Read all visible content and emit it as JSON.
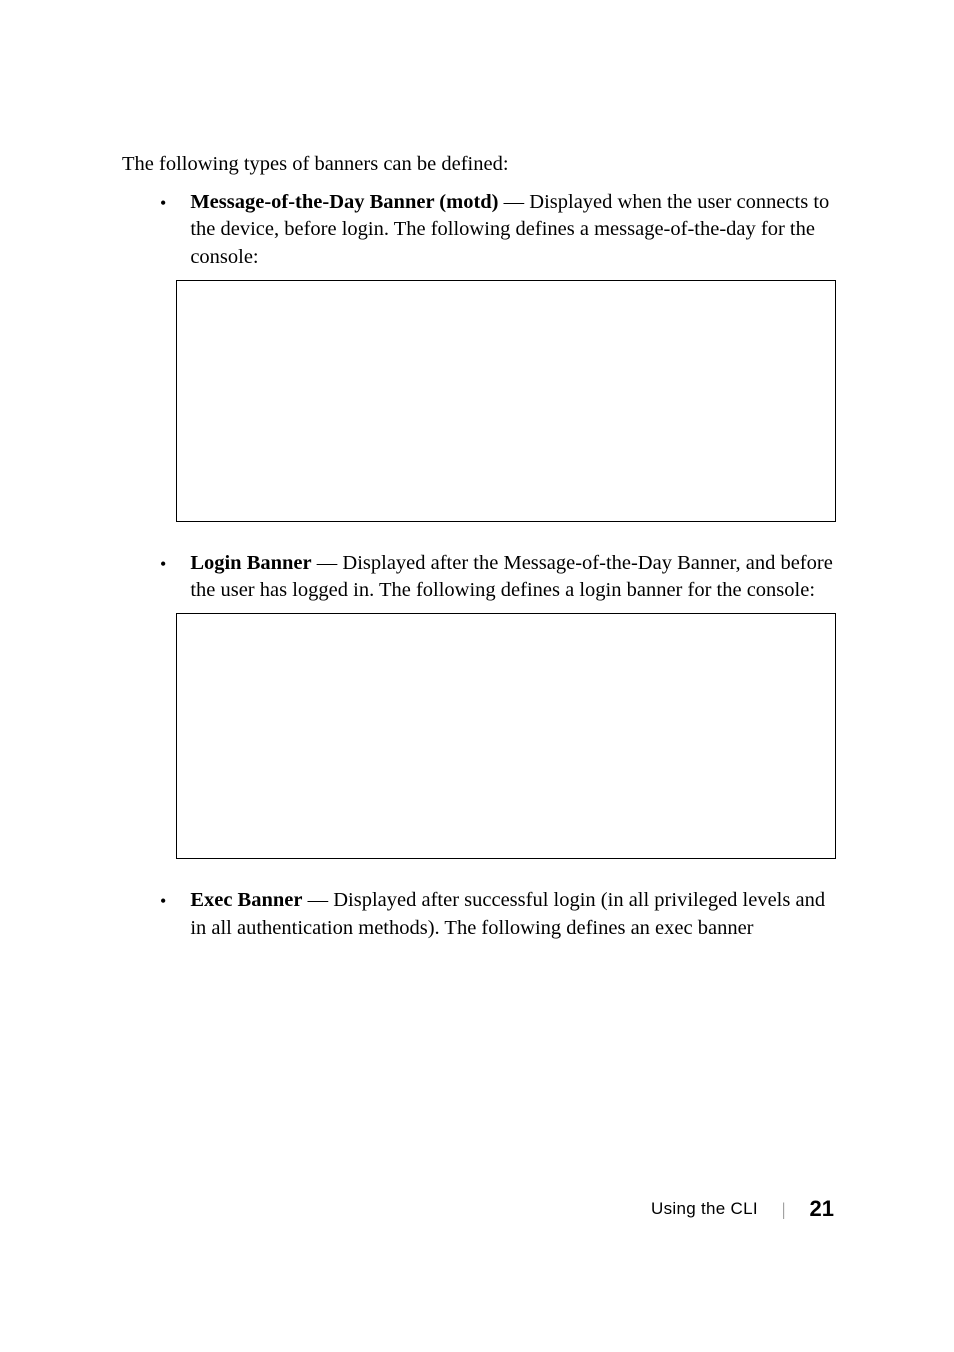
{
  "intro": "The following types of banners can be defined:",
  "items": [
    {
      "bold": "Message-of-the-Day Banner (motd)",
      "rest": " — Displayed when the user connects to the device, before login. The following defines a message-of-the-day for the console:"
    },
    {
      "bold": "Login Banner",
      "rest": " — Displayed after the Message-of-the-Day Banner, and before the user has logged in. The following defines a login banner for the console:"
    },
    {
      "bold": "Exec Banner",
      "rest": " — Displayed after successful login (in all privileged levels and in all authentication methods). The following defines an exec banner"
    }
  ],
  "footer": {
    "title": "Using the CLI",
    "page": "21"
  }
}
